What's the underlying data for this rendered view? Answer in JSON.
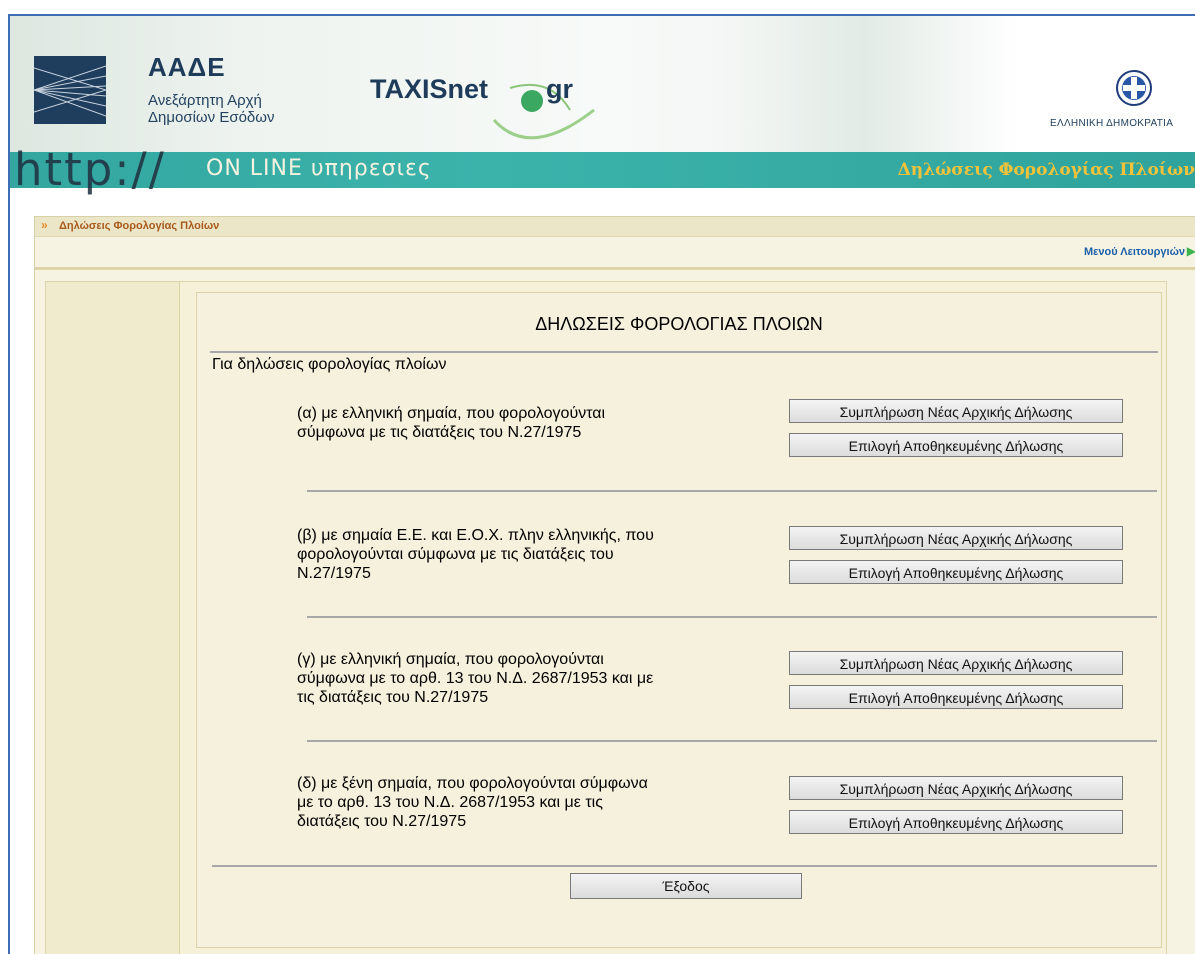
{
  "header": {
    "org_acronym": "ΑΑΔΕ",
    "org_line1": "Ανεξάρτητη Αρχή",
    "org_line2": "Δημοσίων Εσόδων",
    "taxis_name": "TAXISnet",
    "taxis_suffix": "gr",
    "gov_label": "ΕΛΛΗΝΙΚΗ ΔΗΜΟΚΡΑΤΙΑ"
  },
  "band": {
    "http_text": "http://",
    "online_text": "ON LINE υπηρεσιες",
    "section_title": "Δηλώσεις Φορολογίας Πλοίων"
  },
  "breadcrumb": {
    "label": "Δηλώσεις Φορολογίας Πλοίων"
  },
  "menu": {
    "label": "Μενού Λειτουργιών"
  },
  "main": {
    "title": "ΔΗΛΩΣΕΙΣ ΦΟΡΟΛΟΓΙΑΣ ΠΛΟΙΩΝ",
    "intro": "Για δηλώσεις φορολογίας πλοίων",
    "items": [
      {
        "lines": [
          "(α) με ελληνική σημαία, που φορολογούνται",
          "σύμφωνα με τις διατάξεις του Ν.27/1975",
          ""
        ],
        "new_btn": "Συμπλήρωση Νέας Αρχικής Δήλωσης",
        "saved_btn": "Επιλογή Αποθηκευμένης Δήλωσης"
      },
      {
        "lines": [
          "(β) με σημαία Ε.Ε. και Ε.Ο.Χ. πλην ελληνικής, που",
          "φορολογούνται σύμφωνα με τις διατάξεις του",
          "Ν.27/1975"
        ],
        "new_btn": "Συμπλήρωση Νέας Αρχικής Δήλωσης",
        "saved_btn": "Επιλογή Αποθηκευμένης Δήλωσης"
      },
      {
        "lines": [
          "(γ) με ελληνική σημαία, που φορολογούνται",
          "σύμφωνα με το αρθ. 13 του Ν.Δ. 2687/1953 και με",
          "τις διατάξεις του Ν.27/1975"
        ],
        "new_btn": "Συμπλήρωση Νέας Αρχικής Δήλωσης",
        "saved_btn": "Επιλογή Αποθηκευμένης Δήλωσης"
      },
      {
        "lines": [
          "(δ) με ξένη σημαία, που φορολογούνται σύμφωνα",
          "με το αρθ. 13 του Ν.Δ. 2687/1953 και με τις",
          "διατάξεις του Ν.27/1975"
        ],
        "new_btn": "Συμπλήρωση Νέας Αρχικής Δήλωσης",
        "saved_btn": "Επιλογή Αποθηκευμένης Δήλωσης"
      }
    ],
    "exit_btn": "Έξοδος"
  },
  "colors": {
    "band_teal": "#3bb3ab",
    "band_title": "#f2c33a",
    "breadcrumb_text": "#a85a1a",
    "menu_link": "#1b60a8",
    "panel_bg": "#f5f0d8"
  },
  "icons": [
    "aade-logo-icon",
    "greek-emblem-icon",
    "chevron-double-right-icon",
    "arrow-right-icon"
  ]
}
